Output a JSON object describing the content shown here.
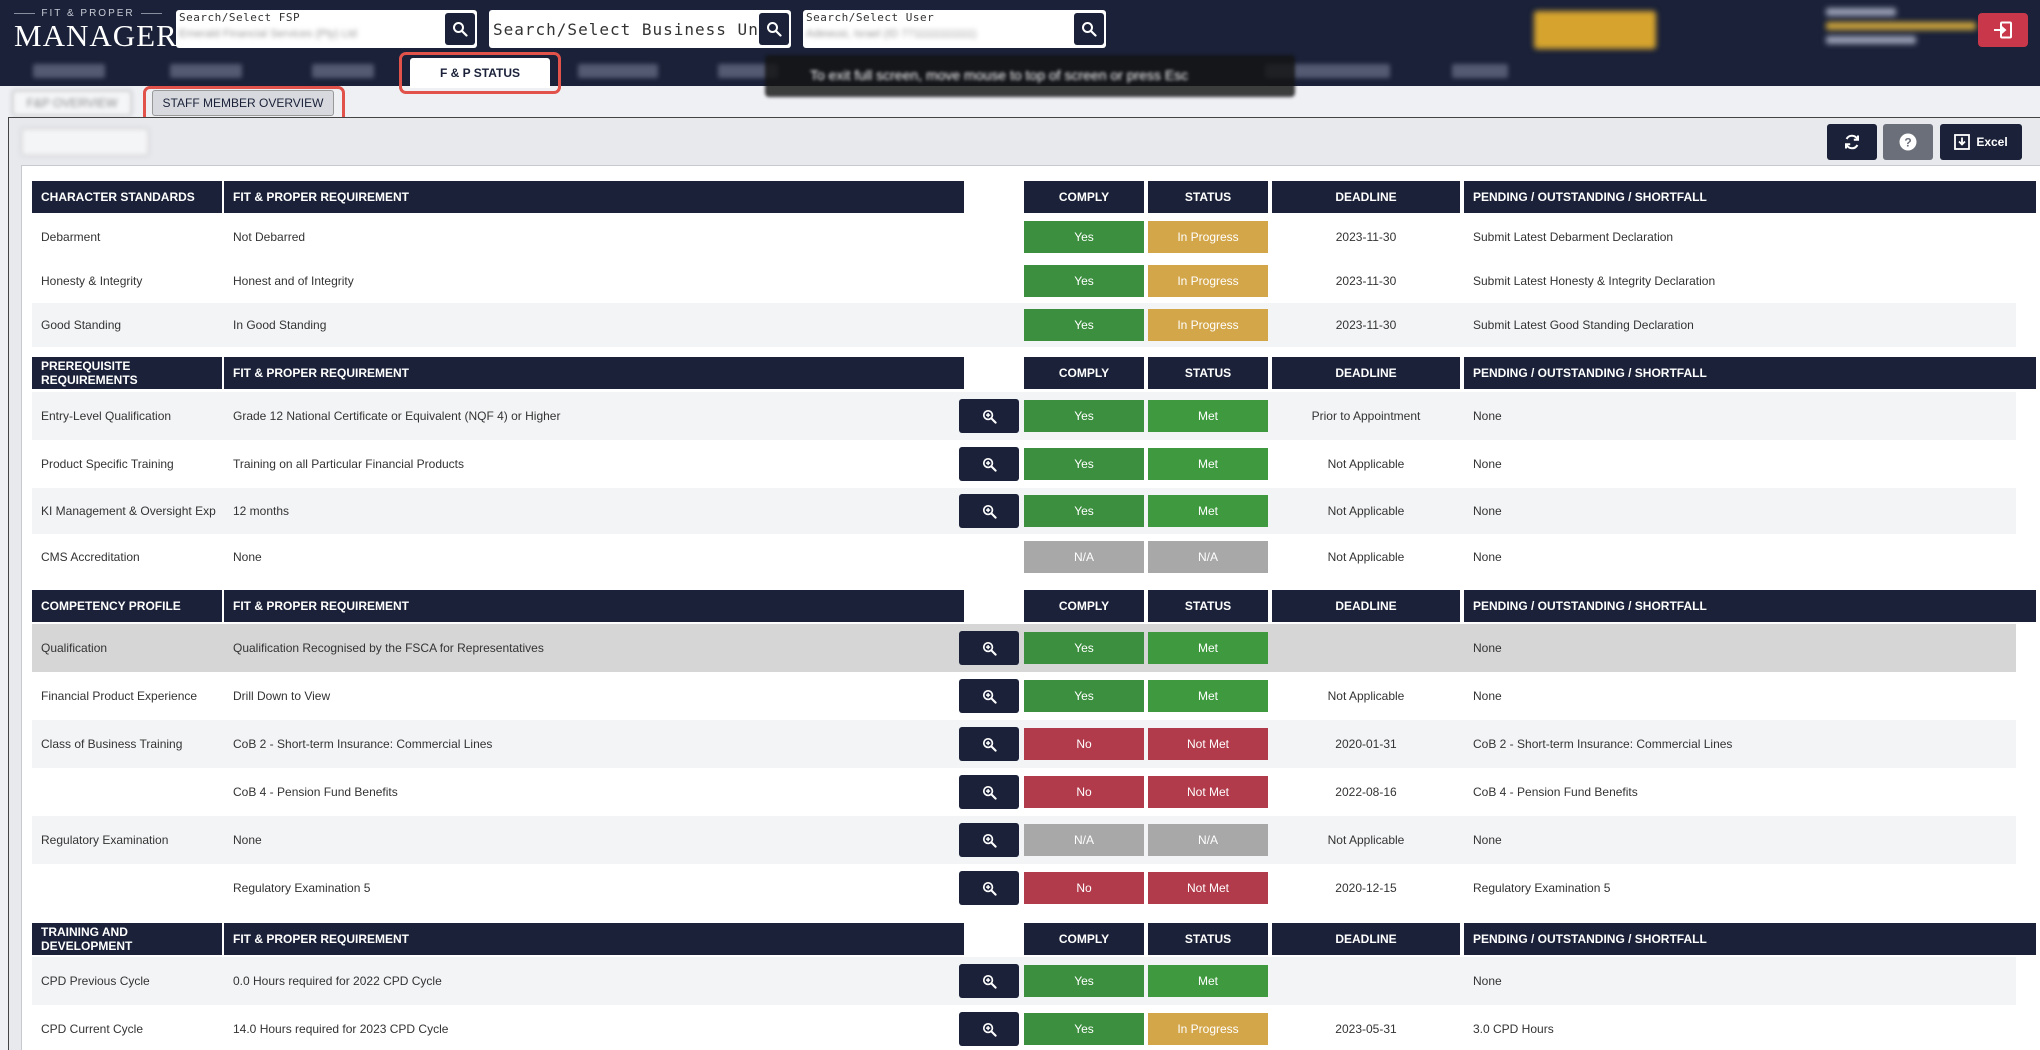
{
  "brand": {
    "subtitle": "FIT & PROPER",
    "title": "MANAGER"
  },
  "search_fsp": {
    "label": "Search/Select FSP",
    "value": "Emerald Financial Services (Pty) Ltd"
  },
  "search_bu": {
    "placeholder": "Search/Select Business Unit"
  },
  "search_user": {
    "label": "Search/Select User",
    "value": "Adewusi, Israel (ID 7711111111111)"
  },
  "nav": {
    "active_tab": "F & P STATUS"
  },
  "toast": {
    "text": "To exit full screen, move mouse to top of screen or press Esc"
  },
  "subtabs": {
    "inactive": "F&P OVERVIEW",
    "active": "STAFF MEMBER OVERVIEW"
  },
  "toolbar": {
    "excel_label": "Excel"
  },
  "colors": {
    "navy": "#1a2138",
    "yes_green": "#3b8f3e",
    "met_green": "#3f9a3f",
    "in_progress": "#d3a64a",
    "no_red": "#b13b4b",
    "na_grey": "#a8a8a8"
  },
  "headers": {
    "requirement": "FIT & PROPER REQUIREMENT",
    "comply": "COMPLY",
    "status": "STATUS",
    "deadline": "DEADLINE",
    "pending": "PENDING / OUTSTANDING / SHORTFALL"
  },
  "sections": [
    {
      "title": "CHARACTER STANDARDS",
      "rows": [
        {
          "category": "Debarment",
          "requirement": "Not Debarred",
          "comply": "Yes",
          "status": "In Progress",
          "deadline": "2023-11-30",
          "pending": "Submit Latest Debarment Declaration"
        },
        {
          "category": "Honesty & Integrity",
          "requirement": "Honest and of Integrity",
          "comply": "Yes",
          "status": "In Progress",
          "deadline": "2023-11-30",
          "pending": "Submit Latest Honesty & Integrity Declaration"
        },
        {
          "category": "Good Standing",
          "requirement": "In Good Standing",
          "comply": "Yes",
          "status": "In Progress",
          "deadline": "2023-11-30",
          "pending": "Submit Latest Good Standing Declaration"
        }
      ]
    },
    {
      "title": "PREREQUISITE REQUIREMENTS",
      "rows": [
        {
          "category": "Entry-Level Qualification",
          "requirement": "Grade 12 National Certificate or Equivalent (NQF 4) or Higher",
          "comply": "Yes",
          "status": "Met",
          "deadline": "Prior to Appointment",
          "pending": "None"
        },
        {
          "category": "Product Specific Training",
          "requirement": "Training on all Particular Financial Products",
          "comply": "Yes",
          "status": "Met",
          "deadline": "Not Applicable",
          "pending": "None"
        },
        {
          "category": "KI Management & Oversight Exp",
          "requirement": "12 months",
          "comply": "Yes",
          "status": "Met",
          "deadline": "Not Applicable",
          "pending": "None"
        },
        {
          "category": "CMS Accreditation",
          "requirement": "None",
          "comply": "N/A",
          "status": "N/A",
          "deadline": "Not Applicable",
          "pending": "None"
        }
      ]
    },
    {
      "title": "COMPETENCY PROFILE",
      "rows": [
        {
          "category": "Qualification",
          "requirement": "Qualification Recognised by the FSCA for Representatives",
          "comply": "Yes",
          "status": "Met",
          "deadline": "",
          "pending": "None"
        },
        {
          "category": "Financial Product Experience",
          "requirement": "Drill Down to View",
          "comply": "Yes",
          "status": "Met",
          "deadline": "Not Applicable",
          "pending": "None"
        },
        {
          "category": "Class of Business Training",
          "requirement": "CoB 2 - Short-term Insurance: Commercial Lines",
          "comply": "No",
          "status": "Not Met",
          "deadline": "2020-01-31",
          "pending": "CoB 2 - Short-term Insurance: Commercial Lines"
        },
        {
          "category": "",
          "requirement": "CoB 4 - Pension Fund Benefits",
          "comply": "No",
          "status": "Not Met",
          "deadline": "2022-08-16",
          "pending": "CoB 4 - Pension Fund Benefits"
        },
        {
          "category": "Regulatory Examination",
          "requirement": "None",
          "comply": "N/A",
          "status": "N/A",
          "deadline": "Not Applicable",
          "pending": "None"
        },
        {
          "category": "",
          "requirement": "Regulatory Examination 5",
          "comply": "No",
          "status": "Not Met",
          "deadline": "2020-12-15",
          "pending": "Regulatory Examination 5"
        }
      ]
    },
    {
      "title": "TRAINING AND DEVELOPMENT",
      "rows": [
        {
          "category": "CPD Previous Cycle",
          "requirement": "0.0 Hours required for 2022 CPD Cycle",
          "comply": "Yes",
          "status": "Met",
          "deadline": "",
          "pending": "None"
        },
        {
          "category": "CPD Current Cycle",
          "requirement": "14.0 Hours required for 2023 CPD Cycle",
          "comply": "Yes",
          "status": "In Progress",
          "deadline": "2023-05-31",
          "pending": "3.0 CPD Hours"
        }
      ]
    }
  ]
}
